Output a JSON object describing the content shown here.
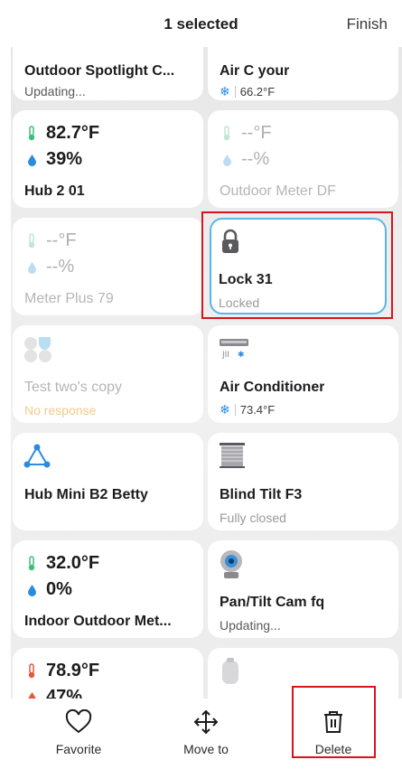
{
  "header": {
    "title": "1 selected",
    "finish_label": "Finish"
  },
  "cards": {
    "c0": {
      "name": "Outdoor Spotlight C...",
      "status": "Updating..."
    },
    "c1": {
      "name": "Air C your",
      "temp": "66.2°F"
    },
    "c2": {
      "temp": "82.7°F",
      "humidity": "39%",
      "name": "Hub 2 01"
    },
    "c3": {
      "temp": "--°F",
      "humidity": "--%",
      "name": "Outdoor Meter DF"
    },
    "c4": {
      "temp": "--°F",
      "humidity": "--%",
      "name": "Meter Plus 79"
    },
    "c5": {
      "name": "Lock 31",
      "status": "Locked"
    },
    "c6": {
      "name": "Test two's copy",
      "status": "No response"
    },
    "c7": {
      "name": "Air Conditioner",
      "temp": "73.4°F"
    },
    "c8": {
      "name": "Hub Mini B2 Betty"
    },
    "c9": {
      "name": "Blind Tilt F3",
      "status": "Fully closed"
    },
    "c10": {
      "temp": "32.0°F",
      "humidity": "0%",
      "name": "Indoor Outdoor Met..."
    },
    "c11": {
      "name": "Pan/Tilt Cam fq",
      "status": "Updating..."
    },
    "c12": {
      "temp": "78.9°F",
      "humidity": "47%"
    }
  },
  "bottom_bar": {
    "favorite_label": "Favorite",
    "move_label": "Move to",
    "delete_label": "Delete"
  },
  "colors": {
    "selected_border": "#58b7e8",
    "highlight_red": "#d8141b",
    "thermo_green": "#3cbf7a",
    "thermo_red": "#e8553a",
    "drop_blue": "#2a8be0"
  },
  "icons": [
    "thermometer-icon",
    "water-drop-icon",
    "snowflake-icon",
    "lock-icon",
    "scene-icon",
    "air-conditioner-icon",
    "hub-mini-icon",
    "blind-tilt-icon",
    "camera-icon",
    "humidifier-icon",
    "heart-icon",
    "move-arrows-icon",
    "trash-icon"
  ]
}
